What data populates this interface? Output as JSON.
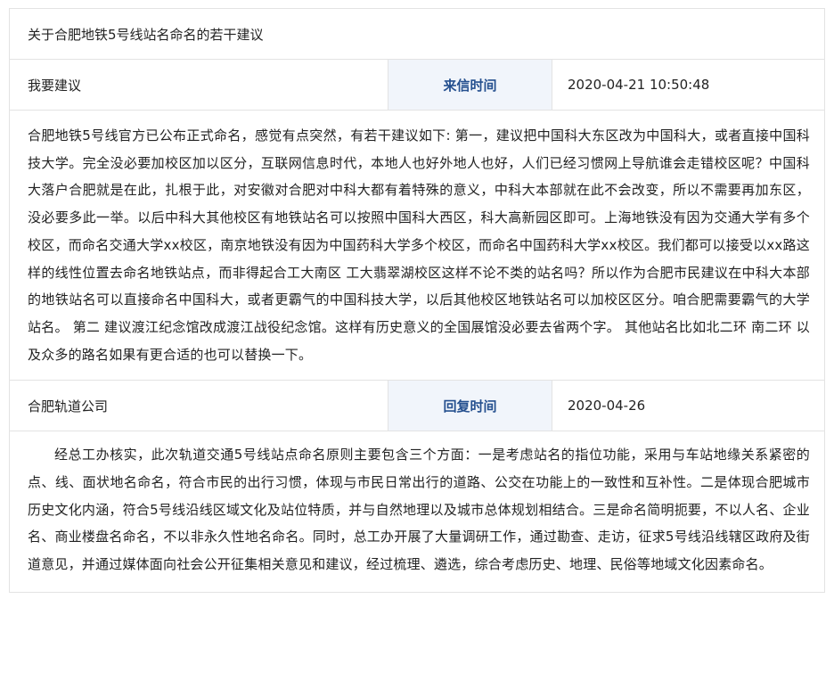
{
  "letter": {
    "title": "关于合肥地铁5号线站名命名的若干建议",
    "category": "我要建议",
    "time_label": "来信时间",
    "time_value": "2020-04-21 10:50:48",
    "body": "合肥地铁5号线官方已公布正式命名，感觉有点突然，有若干建议如下: 第一，建议把中国科大东区改为中国科大，或者直接中国科技大学。完全没必要加校区加以区分，互联网信息时代，本地人也好外地人也好，人们已经习惯网上导航谁会走错校区呢？中国科大落户合肥就是在此，扎根于此，对安徽对合肥对中科大都有着特殊的意义，中科大本部就在此不会改变，所以不需要再加东区，没必要多此一举。以后中科大其他校区有地铁站名可以按照中国科大西区，科大高新园区即可。上海地铁没有因为交通大学有多个校区，而命名交通大学xx校区，南京地铁没有因为中国药科大学多个校区，而命名中国药科大学xx校区。我们都可以接受以xx路这样的线性位置去命名地铁站点，而非得起合工大南区 工大翡翠湖校区这样不论不类的站名吗？所以作为合肥市民建议在中科大本部的地铁站名可以直接命名中国科大，或者更霸气的中国科技大学，以后其他校区地铁站名可以加校区区分。咱合肥需要霸气的大学站名。 第二 建议渡江纪念馆改成渡江战役纪念馆。这样有历史意义的全国展馆没必要去省两个字。 其他站名比如北二环 南二环 以及众多的路名如果有更合适的也可以替换一下。"
  },
  "reply": {
    "department": "合肥轨道公司",
    "time_label": "回复时间",
    "time_value": "2020-04-26",
    "body": "经总工办核实，此次轨道交通5号线站点命名原则主要包含三个方面：一是考虑站名的指位功能，采用与车站地缘关系紧密的点、线、面状地名命名，符合市民的出行习惯，体现与市民日常出行的道路、公交在功能上的一致性和互补性。二是体现合肥城市历史文化内涵，符合5号线沿线区域文化及站位特质，并与自然地理以及城市总体规划相结合。三是命名简明扼要，不以人名、企业名、商业楼盘名命名，不以非永久性地名命名。同时，总工办开展了大量调研工作，通过勘查、走访，征求5号线沿线辖区政府及街道意见，并通过媒体面向社会公开征集相关意见和建议，经过梳理、遴选，综合考虑历史、地理、民俗等地域文化因素命名。"
  },
  "colors": {
    "label_text": "#25508f",
    "label_bg": "#f1f5fb",
    "border": "#e3e3e3"
  }
}
